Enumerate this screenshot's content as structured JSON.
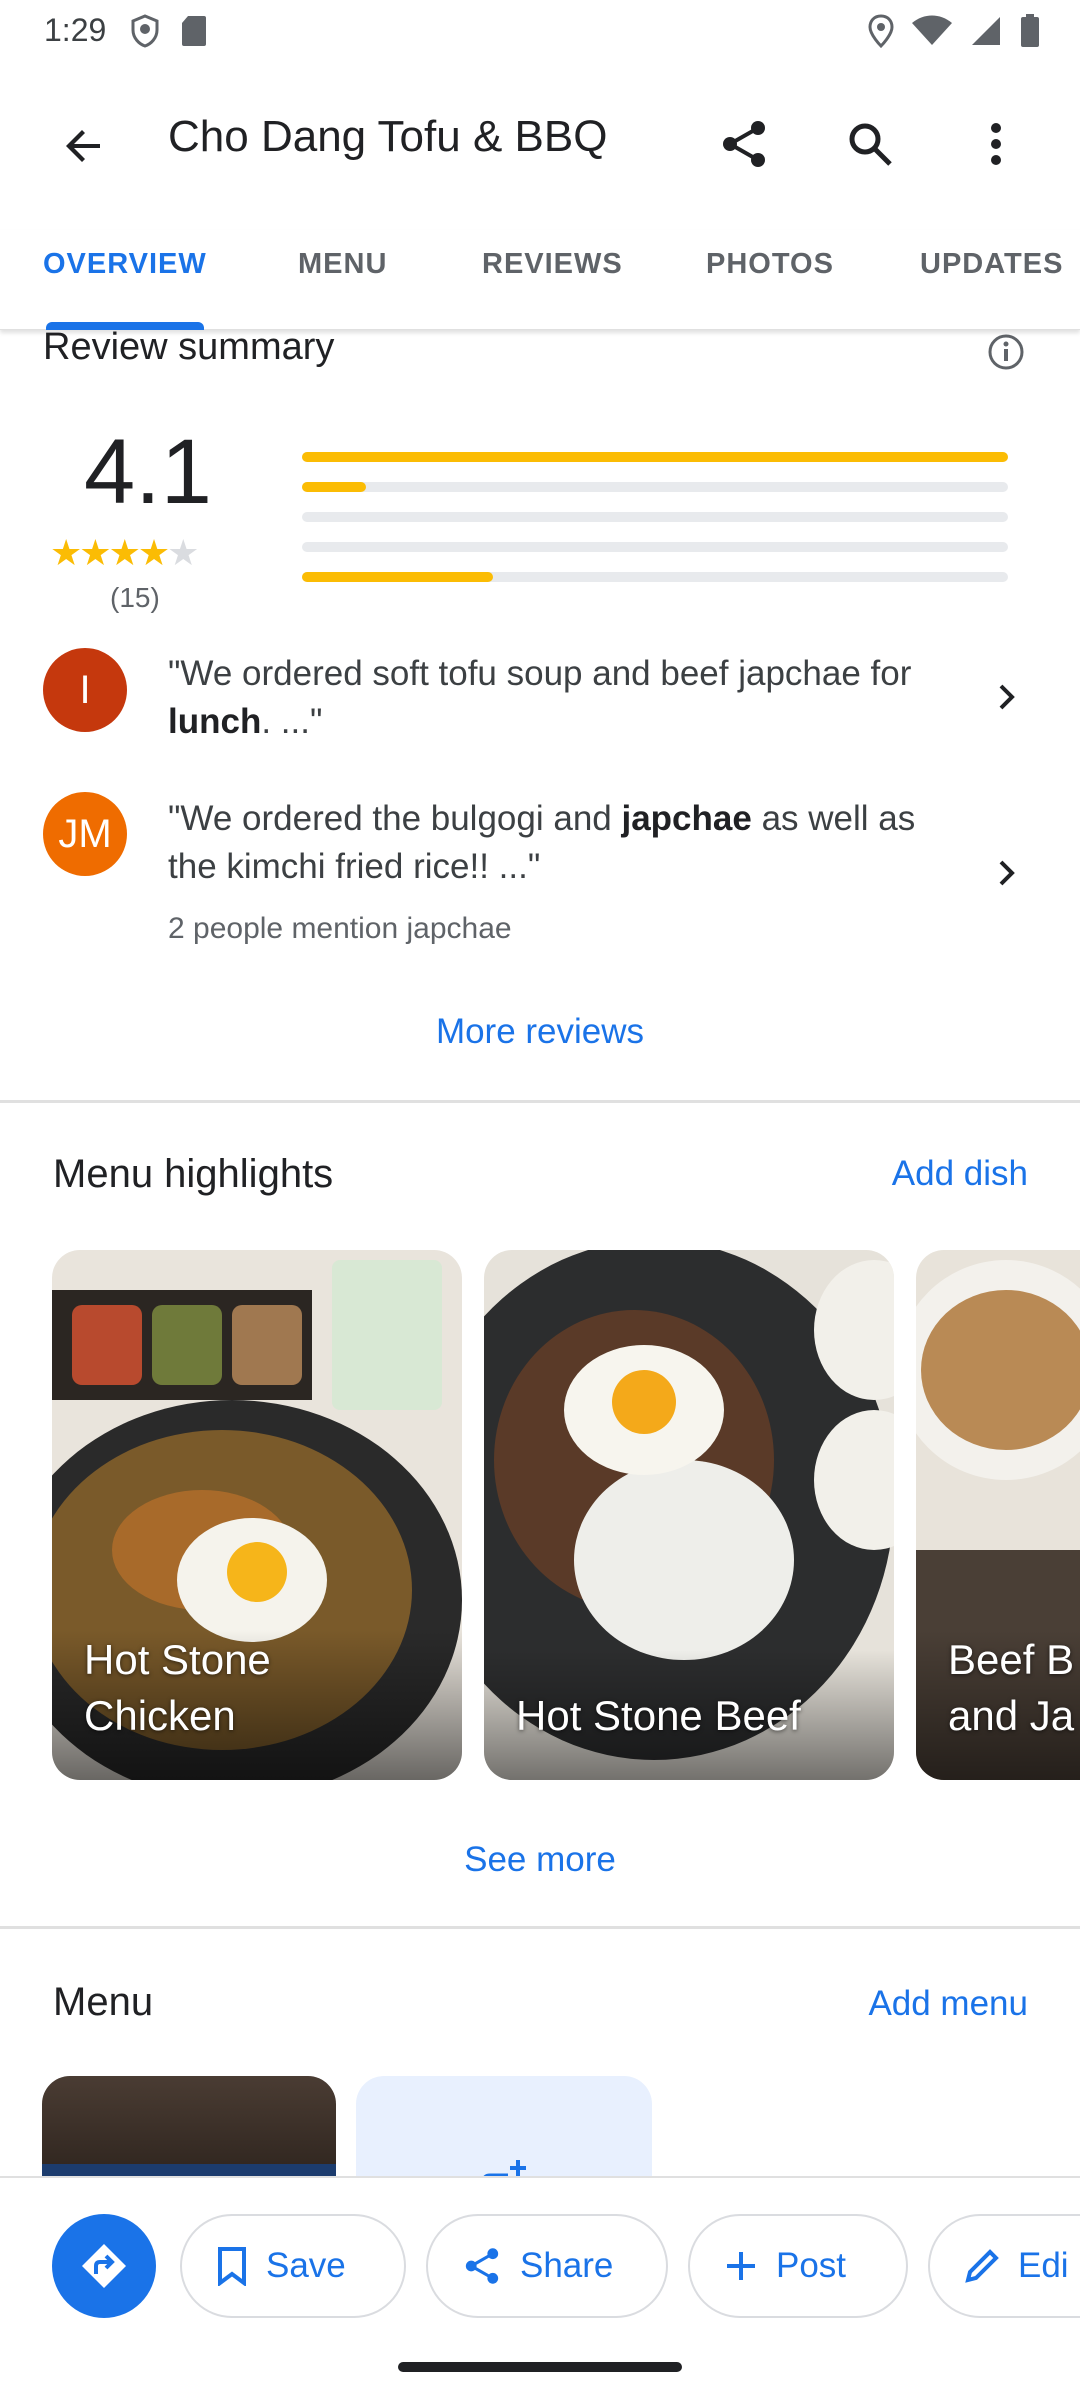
{
  "status_bar": {
    "time": "1:29"
  },
  "app_bar": {
    "title": "Cho Dang Tofu & BBQ"
  },
  "tabs": [
    {
      "label": "OVERVIEW",
      "active": true
    },
    {
      "label": "MENU",
      "active": false
    },
    {
      "label": "REVIEWS",
      "active": false
    },
    {
      "label": "PHOTOS",
      "active": false
    },
    {
      "label": "UPDATES",
      "active": false
    }
  ],
  "review_summary": {
    "title": "Review summary",
    "rating": "4.1",
    "stars": 4,
    "count": "(15)",
    "distribution": [
      {
        "stars": 5,
        "fraction": 1.0
      },
      {
        "stars": 4,
        "fraction": 0.09
      },
      {
        "stars": 3,
        "fraction": 0.0
      },
      {
        "stars": 2,
        "fraction": 0.0
      },
      {
        "stars": 1,
        "fraction": 0.27
      }
    ],
    "snippets": [
      {
        "initial": "I",
        "avatar_color": "#c5380d",
        "text_before": "\"We ordered soft tofu soup and beef japchae for ",
        "bold": "lunch",
        "text_after": ". ...\""
      },
      {
        "initial": "JM",
        "avatar_color": "#ef6c00",
        "text_before": "\"We ordered the bulgogi and ",
        "bold": "japchae",
        "text_after": " as well as the kimchi fried rice!! ...\"",
        "mention": "2 people mention japchae"
      }
    ],
    "more_reviews": "More reviews"
  },
  "menu_highlights": {
    "title": "Menu highlights",
    "action": "Add dish",
    "dishes": [
      {
        "line1": "Hot Stone",
        "line2": "Chicken"
      },
      {
        "line1": "",
        "line2": "Hot Stone Beef"
      },
      {
        "line1": "Beef B",
        "line2": "and Ja"
      }
    ],
    "see_more": "See more"
  },
  "menu": {
    "title": "Menu",
    "action": "Add menu"
  },
  "bottom_actions": {
    "save": "Save",
    "share": "Share",
    "post": "Post",
    "edit": "Edi"
  },
  "colors": {
    "accent": "#1a73e8",
    "star": "#fbbc04"
  }
}
